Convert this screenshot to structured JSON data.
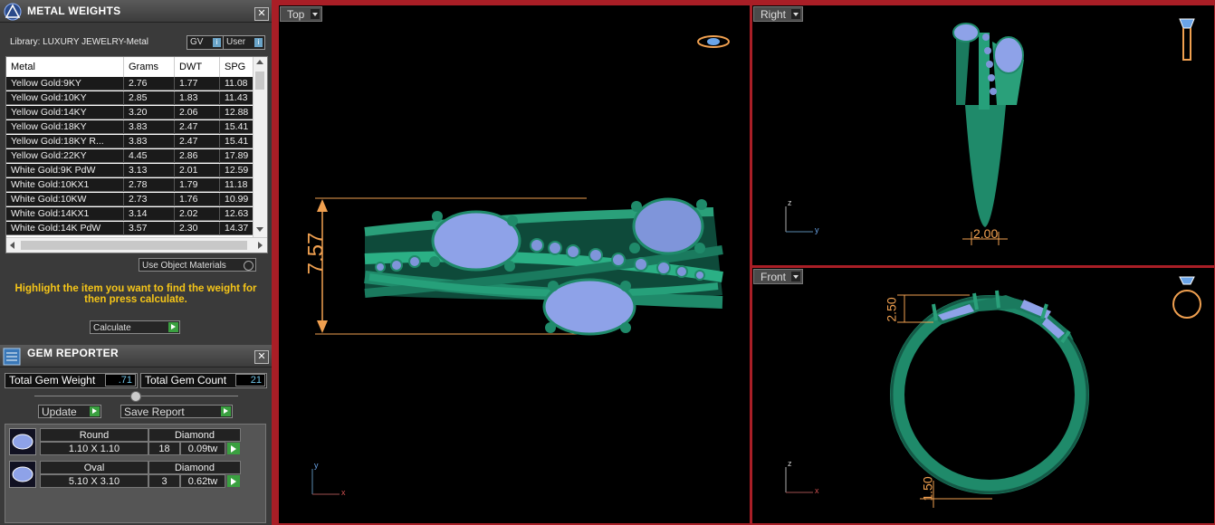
{
  "metal_panel": {
    "title": "METAL WEIGHTS",
    "library": "Library: LUXURY JEWELRY-Metal",
    "toggle_gv": "GV",
    "toggle_user": "User",
    "columns": [
      "Metal",
      "Grams",
      "DWT",
      "SPG"
    ],
    "rows": [
      [
        "Yellow Gold:9KY",
        "2.76",
        "1.77",
        "11.08"
      ],
      [
        "Yellow Gold:10KY",
        "2.85",
        "1.83",
        "11.43"
      ],
      [
        "Yellow Gold:14KY",
        "3.20",
        "2.06",
        "12.88"
      ],
      [
        "Yellow Gold:18KY",
        "3.83",
        "2.47",
        "15.41"
      ],
      [
        "Yellow Gold:18KY R...",
        "3.83",
        "2.47",
        "15.41"
      ],
      [
        "Yellow Gold:22KY",
        "4.45",
        "2.86",
        "17.89"
      ],
      [
        "White Gold:9K PdW",
        "3.13",
        "2.01",
        "12.59"
      ],
      [
        "White Gold:10KX1",
        "2.78",
        "1.79",
        "11.18"
      ],
      [
        "White Gold:10KW",
        "2.73",
        "1.76",
        "10.99"
      ],
      [
        "White Gold:14KX1",
        "3.14",
        "2.02",
        "12.63"
      ],
      [
        "White Gold:14K PdW",
        "3.57",
        "2.30",
        "14.37"
      ]
    ],
    "use_object_materials": "Use Object Materials",
    "hint": "Highlight the item you want to find the weight for then press calculate.",
    "calculate": "Calculate"
  },
  "gem_panel": {
    "title": "GEM REPORTER",
    "total_weight_label": "Total Gem Weight",
    "total_weight_value": ".71",
    "total_count_label": "Total Gem Count",
    "total_count_value": "21",
    "update": "Update",
    "save_report": "Save Report",
    "gems": [
      {
        "shape": "Round",
        "size": "1.10 X 1.10",
        "type": "Diamond",
        "count": "18",
        "weight": "0.09tw"
      },
      {
        "shape": "Oval",
        "size": "5.10 X 3.10",
        "type": "Diamond",
        "count": "3",
        "weight": "0.62tw"
      }
    ]
  },
  "viewports": {
    "top": {
      "label": "Top",
      "dimension": "7.57",
      "axis_y": "y",
      "axis_x": "x"
    },
    "right": {
      "label": "Right",
      "dimension": "2.00",
      "axis_z": "z",
      "axis_y": "y"
    },
    "front": {
      "label": "Front",
      "dimension_top": "2.50",
      "dimension_bottom": "1.50",
      "axis_z": "z",
      "axis_x": "x"
    }
  },
  "colors": {
    "metal": "#1f8a6a",
    "gem": "#8ea2e8",
    "dimension": "#f0a050",
    "frame": "#a91e26"
  }
}
